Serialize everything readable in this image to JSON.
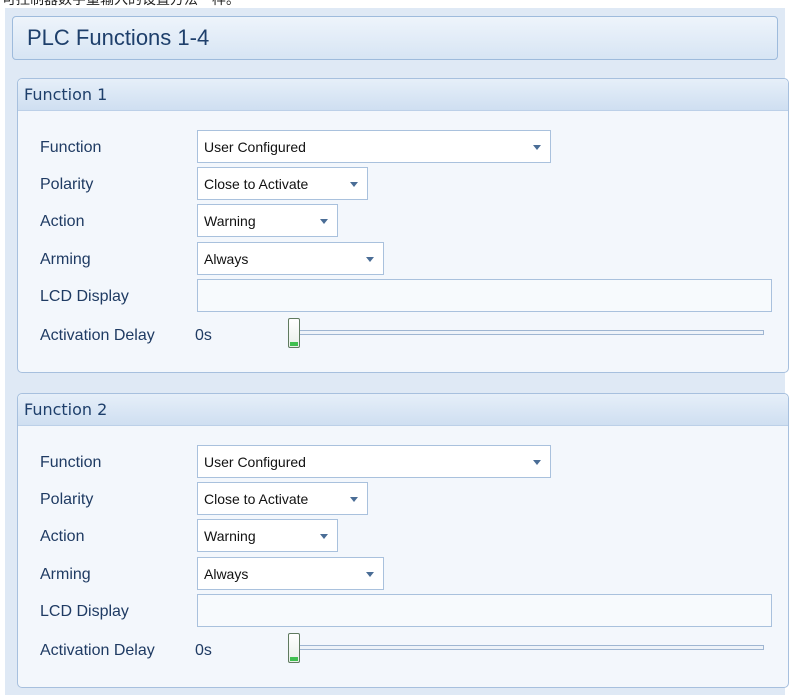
{
  "top_caption": "可控制器数字量输入的设置方法一样。",
  "header": {
    "title": "PLC Functions 1-4"
  },
  "labels": {
    "function": "Function",
    "polarity": "Polarity",
    "action": "Action",
    "arming": "Arming",
    "lcd_display": "LCD Display",
    "activation_delay": "Activation Delay"
  },
  "functions": [
    {
      "title": "Function 1",
      "function_value": "User Configured",
      "polarity_value": "Close to Activate",
      "action_value": "Warning",
      "arming_value": "Always",
      "lcd_display_value": "",
      "activation_delay_value": "0s",
      "activation_delay_level": 0
    },
    {
      "title": "Function 2",
      "function_value": "User Configured",
      "polarity_value": "Close to Activate",
      "action_value": "Warning",
      "arming_value": "Always",
      "lcd_display_value": "",
      "activation_delay_value": "0s",
      "activation_delay_level": 0
    }
  ],
  "icons": {
    "dropdown": "chevron-down-icon",
    "slider": "slider-thumb"
  }
}
